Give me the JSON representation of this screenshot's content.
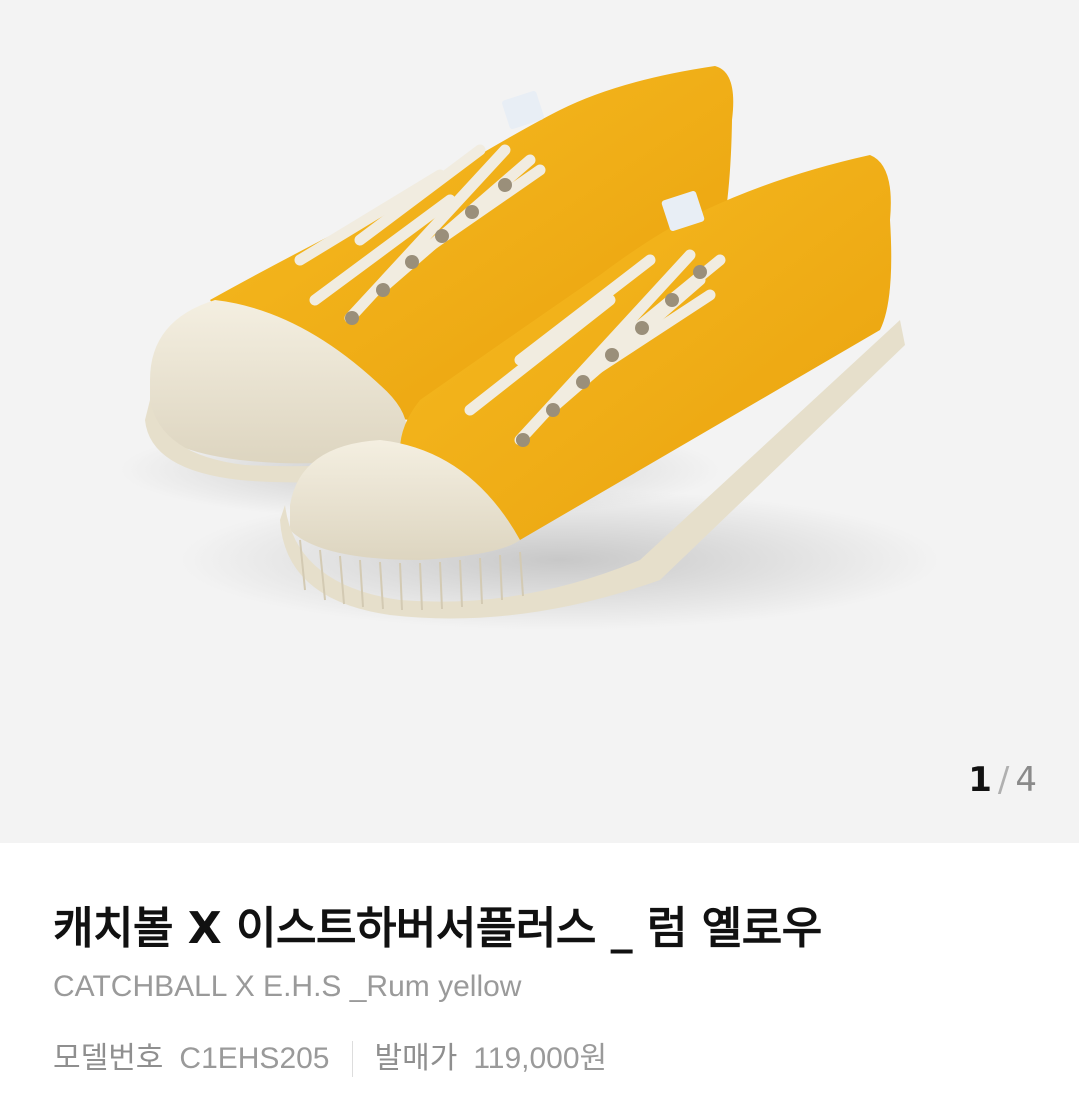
{
  "gallery": {
    "image_alt": "Yellow canvas low-top sneakers pair",
    "current": "1",
    "separator": "/",
    "total": "4",
    "colors": {
      "background": "#f3f3f3",
      "canvas": "#f2ae14",
      "sole": "#efe9d9"
    }
  },
  "product": {
    "title": "캐치볼 X 이스트하버서플러스 _ 럼 옐로우",
    "subtitle": "CATCHBALL X E.H.S _Rum yellow",
    "model_label": "모델번호",
    "model_value": "C1EHS205",
    "price_label": "발매가",
    "price_value": "119,000원"
  }
}
